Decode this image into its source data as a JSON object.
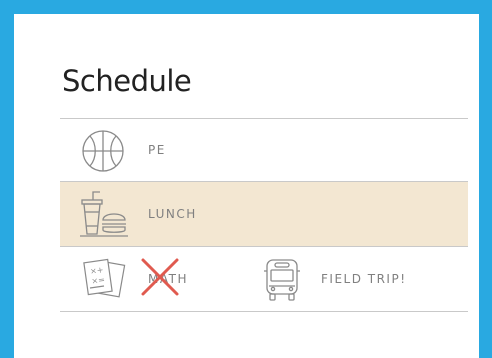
{
  "schedule": {
    "title": "Schedule",
    "items": [
      {
        "label": "PE",
        "icon": "basketball-icon"
      },
      {
        "label": "LUNCH",
        "icon": "burger-drink-icon",
        "highlight": "#f3e7d2"
      },
      {
        "label": "MATH",
        "icon": "worksheet-icon",
        "status": "cancelled",
        "status_icon": "red-x-icon"
      },
      {
        "label": "FIELD TRIP!",
        "icon": "bus-icon"
      }
    ]
  },
  "colors": {
    "frame": "#29a9e1",
    "highlight": "#f3e7d2",
    "cancel": "#e05a4f",
    "text": "#808080"
  }
}
